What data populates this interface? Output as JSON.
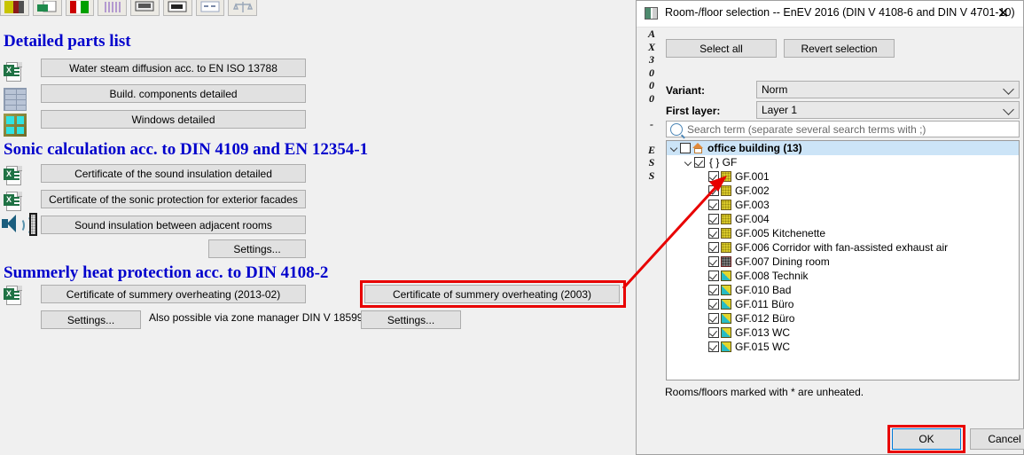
{
  "toolbar": {
    "icons": [
      "palette-icon",
      "document-export-icon",
      "color-blocks-icon",
      "radiator-icon",
      "print-preview-icon",
      "report-icon",
      "table-icon",
      "balance-icon"
    ]
  },
  "left_panel": {
    "sections": [
      {
        "id": "parts",
        "title": "Detailed parts list",
        "rows": [
          {
            "icon": "excel-icon",
            "label": "Water steam diffusion acc. to EN ISO 13788"
          },
          {
            "icon": "brick-wall-icon",
            "label": "Build. components detailed"
          },
          {
            "icon": "window-icon",
            "label": "Windows detailed"
          }
        ]
      },
      {
        "id": "sonic",
        "title": "Sonic calculation acc. to DIN 4109 and EN 12354-1",
        "rows": [
          {
            "icon": "excel-icon",
            "label": "Certificate of the sound insulation detailed"
          },
          {
            "icon": "excel-icon",
            "label": "Certificate of the sonic protection for exterior facades"
          },
          {
            "icon": "speaker-icon",
            "label": "Sound insulation between adjacent rooms"
          }
        ],
        "settings_label": "Settings..."
      },
      {
        "id": "summer",
        "title": "Summerly heat protection acc. to DIN 4108-2",
        "rows": [
          {
            "icon": "excel-icon",
            "label": "Certificate of summery overheating (2013-02)"
          }
        ],
        "settings_label": "Settings...",
        "hint": "Also possible via zone manager DIN V 18599"
      }
    ],
    "middle_column": {
      "highlighted_button": "Certificate of summery overheating (2003)",
      "settings_label": "Settings..."
    }
  },
  "dialog": {
    "title": "Room-/floor selection -- EnEV 2016 (DIN V 4108-6 and DIN V 4701-10)",
    "title_icon": "window-app-icon",
    "close_icon": "close-icon",
    "vertical_text": "AX3000 - ESS",
    "select_all_label": "Select all",
    "revert_label": "Revert selection",
    "variant_label": "Variant:",
    "variant_value": "Norm",
    "first_layer_label": "First layer:",
    "first_layer_value": "Layer 1",
    "search_placeholder": "Search term (separate several search terms with ;)",
    "search_icon": "search-icon",
    "tree": [
      {
        "level": 0,
        "label": "office building (13)",
        "checked": false,
        "bold": true,
        "selected": true,
        "expanded": true,
        "icon": "house-icon"
      },
      {
        "level": 1,
        "label": "{  } GF",
        "checked": true,
        "bold": false,
        "selected": false,
        "expanded": true,
        "icon": "none"
      },
      {
        "level": 2,
        "label": "GF.001",
        "checked": true,
        "icon": "room-yellow-icon"
      },
      {
        "level": 2,
        "label": "GF.002",
        "checked": true,
        "icon": "room-yellow-icon"
      },
      {
        "level": 2,
        "label": "GF.003",
        "checked": true,
        "icon": "room-yellow-icon"
      },
      {
        "level": 2,
        "label": "GF.004",
        "checked": true,
        "icon": "room-yellow-icon"
      },
      {
        "level": 2,
        "label": "GF.005 Kitchenette",
        "checked": true,
        "icon": "room-yellow-icon"
      },
      {
        "level": 2,
        "label": "GF.006 Corridor with fan-assisted exhaust air",
        "checked": true,
        "icon": "room-yellow-icon"
      },
      {
        "level": 2,
        "label": "GF.007 Dining room",
        "checked": true,
        "icon": "room-gray-icon"
      },
      {
        "level": 2,
        "label": "GF.008 Technik",
        "checked": true,
        "icon": "room-cyan-icon"
      },
      {
        "level": 2,
        "label": "GF.010 Bad",
        "checked": true,
        "icon": "room-cyan-icon"
      },
      {
        "level": 2,
        "label": "GF.011 Büro",
        "checked": true,
        "icon": "room-cyan-icon"
      },
      {
        "level": 2,
        "label": "GF.012 Büro",
        "checked": true,
        "icon": "room-cyan-icon"
      },
      {
        "level": 2,
        "label": "GF.013 WC",
        "checked": true,
        "icon": "room-cyan-icon"
      },
      {
        "level": 2,
        "label": "GF.015 WC",
        "checked": true,
        "icon": "room-cyan-icon"
      }
    ],
    "footnote": "Rooms/floors marked with * are unheated.",
    "ok_label": "OK",
    "cancel_label": "Cancel"
  },
  "annotations": {
    "highlight_color": "#e80000",
    "arrow": "red-arrow-annotation"
  },
  "colors": {
    "heading": "#0000cc",
    "selection": "#cce4f7",
    "focus": "#0078d7",
    "highlight": "#e80000"
  }
}
